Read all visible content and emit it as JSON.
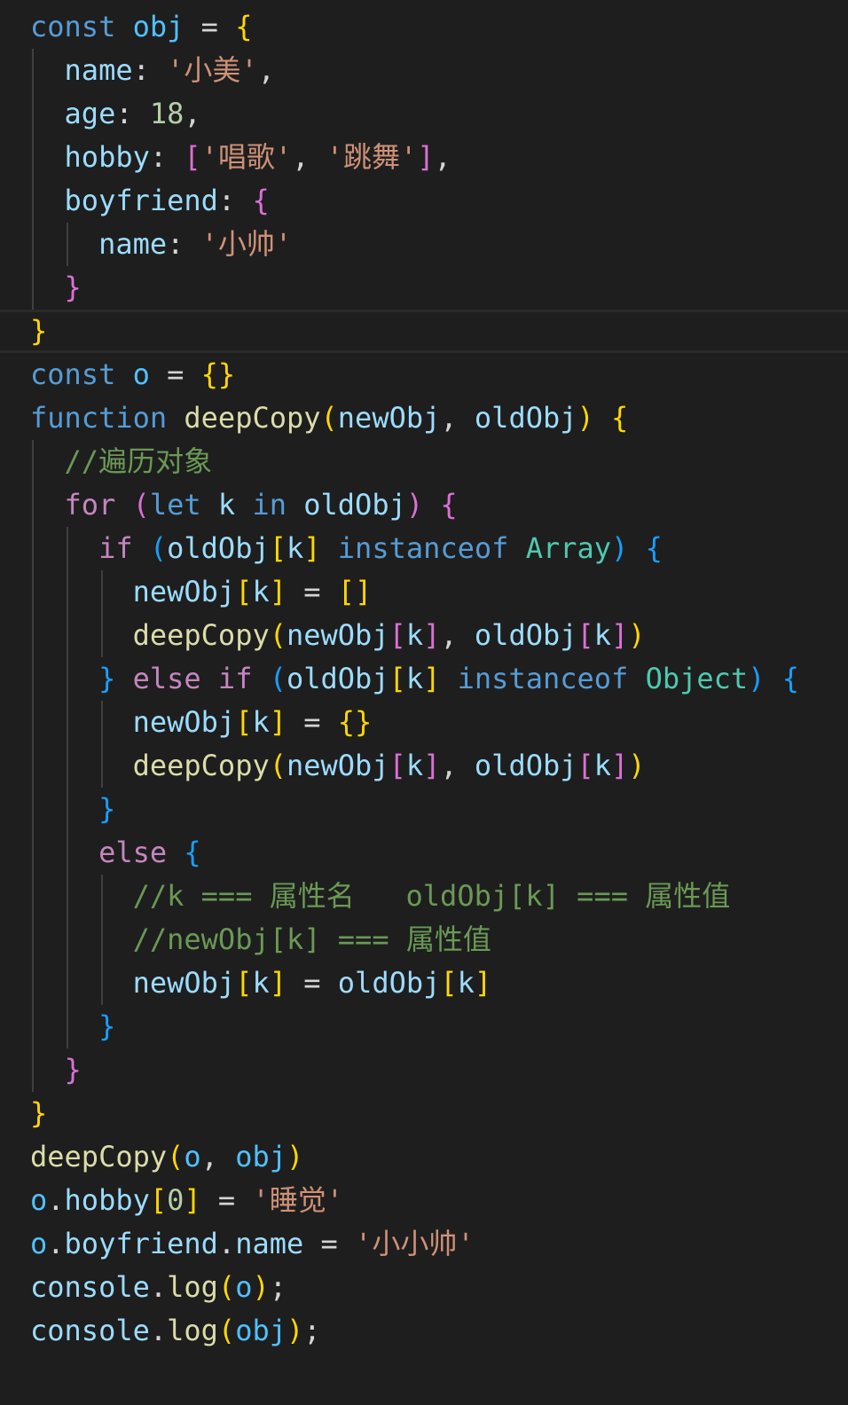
{
  "editor": {
    "language": "javascript",
    "theme_colors": {
      "background": "#1e1e1e",
      "keyword": "#569cd6",
      "control": "#c586c0",
      "variable": "#9cdcfe",
      "constant": "#4fc1ff",
      "function": "#dcdcaa",
      "string": "#ce9178",
      "number": "#b5cea8",
      "type": "#4ec9b0",
      "comment": "#6a9955",
      "bracket_level_1": "#ffd700",
      "bracket_level_2": "#da70d6",
      "bracket_level_3": "#179fff"
    },
    "current_line": 8,
    "lines": [
      [
        [
          "kw",
          "const"
        ],
        [
          "op",
          " "
        ],
        [
          "cst",
          "obj"
        ],
        [
          "op",
          " = "
        ],
        [
          "b1",
          "{"
        ]
      ],
      [
        [
          "op",
          "  "
        ],
        [
          "var",
          "name"
        ],
        [
          "op",
          ": "
        ],
        [
          "str",
          "'小美'"
        ],
        [
          "op",
          ","
        ]
      ],
      [
        [
          "op",
          "  "
        ],
        [
          "var",
          "age"
        ],
        [
          "op",
          ": "
        ],
        [
          "num",
          "18"
        ],
        [
          "op",
          ","
        ]
      ],
      [
        [
          "op",
          "  "
        ],
        [
          "var",
          "hobby"
        ],
        [
          "op",
          ": "
        ],
        [
          "b2",
          "["
        ],
        [
          "str",
          "'唱歌'"
        ],
        [
          "op",
          ", "
        ],
        [
          "str",
          "'跳舞'"
        ],
        [
          "b2",
          "]"
        ],
        [
          "op",
          ","
        ]
      ],
      [
        [
          "op",
          "  "
        ],
        [
          "var",
          "boyfriend"
        ],
        [
          "op",
          ": "
        ],
        [
          "b2",
          "{"
        ]
      ],
      [
        [
          "op",
          "    "
        ],
        [
          "var",
          "name"
        ],
        [
          "op",
          ": "
        ],
        [
          "str",
          "'小帅'"
        ]
      ],
      [
        [
          "op",
          "  "
        ],
        [
          "b2",
          "}"
        ]
      ],
      [
        [
          "b1",
          "}"
        ]
      ],
      [
        [
          "kw",
          "const"
        ],
        [
          "op",
          " "
        ],
        [
          "cst",
          "o"
        ],
        [
          "op",
          " = "
        ],
        [
          "b1",
          "{}"
        ]
      ],
      [
        [
          "kw",
          "function"
        ],
        [
          "op",
          " "
        ],
        [
          "fn",
          "deepCopy"
        ],
        [
          "b1",
          "("
        ],
        [
          "var",
          "newObj"
        ],
        [
          "op",
          ", "
        ],
        [
          "var",
          "oldObj"
        ],
        [
          "b1",
          ")"
        ],
        [
          "op",
          " "
        ],
        [
          "b1",
          "{"
        ]
      ],
      [
        [
          "op",
          "  "
        ],
        [
          "com",
          "//遍历对象"
        ]
      ],
      [
        [
          "op",
          "  "
        ],
        [
          "ctl",
          "for"
        ],
        [
          "op",
          " "
        ],
        [
          "b2",
          "("
        ],
        [
          "kw",
          "let"
        ],
        [
          "op",
          " "
        ],
        [
          "var",
          "k"
        ],
        [
          "op",
          " "
        ],
        [
          "kw",
          "in"
        ],
        [
          "op",
          " "
        ],
        [
          "var",
          "oldObj"
        ],
        [
          "b2",
          ")"
        ],
        [
          "op",
          " "
        ],
        [
          "b2",
          "{"
        ]
      ],
      [
        [
          "op",
          "    "
        ],
        [
          "ctl",
          "if"
        ],
        [
          "op",
          " "
        ],
        [
          "b3",
          "("
        ],
        [
          "var",
          "oldObj"
        ],
        [
          "b1",
          "["
        ],
        [
          "var",
          "k"
        ],
        [
          "b1",
          "]"
        ],
        [
          "op",
          " "
        ],
        [
          "kw",
          "instanceof"
        ],
        [
          "op",
          " "
        ],
        [
          "type",
          "Array"
        ],
        [
          "b3",
          ")"
        ],
        [
          "op",
          " "
        ],
        [
          "b3",
          "{"
        ]
      ],
      [
        [
          "op",
          "      "
        ],
        [
          "var",
          "newObj"
        ],
        [
          "b1",
          "["
        ],
        [
          "var",
          "k"
        ],
        [
          "b1",
          "]"
        ],
        [
          "op",
          " = "
        ],
        [
          "b1",
          "[]"
        ]
      ],
      [
        [
          "op",
          "      "
        ],
        [
          "fn",
          "deepCopy"
        ],
        [
          "b1",
          "("
        ],
        [
          "var",
          "newObj"
        ],
        [
          "b2",
          "["
        ],
        [
          "var",
          "k"
        ],
        [
          "b2",
          "]"
        ],
        [
          "op",
          ", "
        ],
        [
          "var",
          "oldObj"
        ],
        [
          "b2",
          "["
        ],
        [
          "var",
          "k"
        ],
        [
          "b2",
          "]"
        ],
        [
          "b1",
          ")"
        ]
      ],
      [
        [
          "op",
          "    "
        ],
        [
          "b3",
          "}"
        ],
        [
          "op",
          " "
        ],
        [
          "ctl",
          "else if"
        ],
        [
          "op",
          " "
        ],
        [
          "b3",
          "("
        ],
        [
          "var",
          "oldObj"
        ],
        [
          "b1",
          "["
        ],
        [
          "var",
          "k"
        ],
        [
          "b1",
          "]"
        ],
        [
          "op",
          " "
        ],
        [
          "kw",
          "instanceof"
        ],
        [
          "op",
          " "
        ],
        [
          "type",
          "Object"
        ],
        [
          "b3",
          ")"
        ],
        [
          "op",
          " "
        ],
        [
          "b3",
          "{"
        ]
      ],
      [
        [
          "op",
          "      "
        ],
        [
          "var",
          "newObj"
        ],
        [
          "b1",
          "["
        ],
        [
          "var",
          "k"
        ],
        [
          "b1",
          "]"
        ],
        [
          "op",
          " = "
        ],
        [
          "b1",
          "{}"
        ]
      ],
      [
        [
          "op",
          "      "
        ],
        [
          "fn",
          "deepCopy"
        ],
        [
          "b1",
          "("
        ],
        [
          "var",
          "newObj"
        ],
        [
          "b2",
          "["
        ],
        [
          "var",
          "k"
        ],
        [
          "b2",
          "]"
        ],
        [
          "op",
          ", "
        ],
        [
          "var",
          "oldObj"
        ],
        [
          "b2",
          "["
        ],
        [
          "var",
          "k"
        ],
        [
          "b2",
          "]"
        ],
        [
          "b1",
          ")"
        ]
      ],
      [
        [
          "op",
          "    "
        ],
        [
          "b3",
          "}"
        ]
      ],
      [
        [
          "op",
          "    "
        ],
        [
          "ctl",
          "else"
        ],
        [
          "op",
          " "
        ],
        [
          "b3",
          "{"
        ]
      ],
      [
        [
          "op",
          "      "
        ],
        [
          "com",
          "//k === 属性名   oldObj[k] === 属性值"
        ]
      ],
      [
        [
          "op",
          "      "
        ],
        [
          "com",
          "//newObj[k] === 属性值"
        ]
      ],
      [
        [
          "op",
          "      "
        ],
        [
          "var",
          "newObj"
        ],
        [
          "b1",
          "["
        ],
        [
          "var",
          "k"
        ],
        [
          "b1",
          "]"
        ],
        [
          "op",
          " = "
        ],
        [
          "var",
          "oldObj"
        ],
        [
          "b1",
          "["
        ],
        [
          "var",
          "k"
        ],
        [
          "b1",
          "]"
        ]
      ],
      [
        [
          "op",
          "    "
        ],
        [
          "b3",
          "}"
        ]
      ],
      [
        [
          "op",
          "  "
        ],
        [
          "b2",
          "}"
        ]
      ],
      [
        [
          "b1",
          "}"
        ]
      ],
      [
        [
          "fn",
          "deepCopy"
        ],
        [
          "b1",
          "("
        ],
        [
          "cst",
          "o"
        ],
        [
          "op",
          ", "
        ],
        [
          "cst",
          "obj"
        ],
        [
          "b1",
          ")"
        ]
      ],
      [
        [
          "cst",
          "o"
        ],
        [
          "op",
          "."
        ],
        [
          "var",
          "hobby"
        ],
        [
          "b1",
          "["
        ],
        [
          "num",
          "0"
        ],
        [
          "b1",
          "]"
        ],
        [
          "op",
          " = "
        ],
        [
          "str",
          "'睡觉'"
        ]
      ],
      [
        [
          "cst",
          "o"
        ],
        [
          "op",
          "."
        ],
        [
          "var",
          "boyfriend"
        ],
        [
          "op",
          "."
        ],
        [
          "var",
          "name"
        ],
        [
          "op",
          " = "
        ],
        [
          "str",
          "'小小帅'"
        ]
      ],
      [
        [
          "var",
          "console"
        ],
        [
          "op",
          "."
        ],
        [
          "fn",
          "log"
        ],
        [
          "b1",
          "("
        ],
        [
          "cst",
          "o"
        ],
        [
          "b1",
          ")"
        ],
        [
          "op",
          ";"
        ]
      ],
      [
        [
          "var",
          "console"
        ],
        [
          "op",
          "."
        ],
        [
          "fn",
          "log"
        ],
        [
          "b1",
          "("
        ],
        [
          "cst",
          "obj"
        ],
        [
          "b1",
          ")"
        ],
        [
          "op",
          ";"
        ]
      ]
    ]
  }
}
